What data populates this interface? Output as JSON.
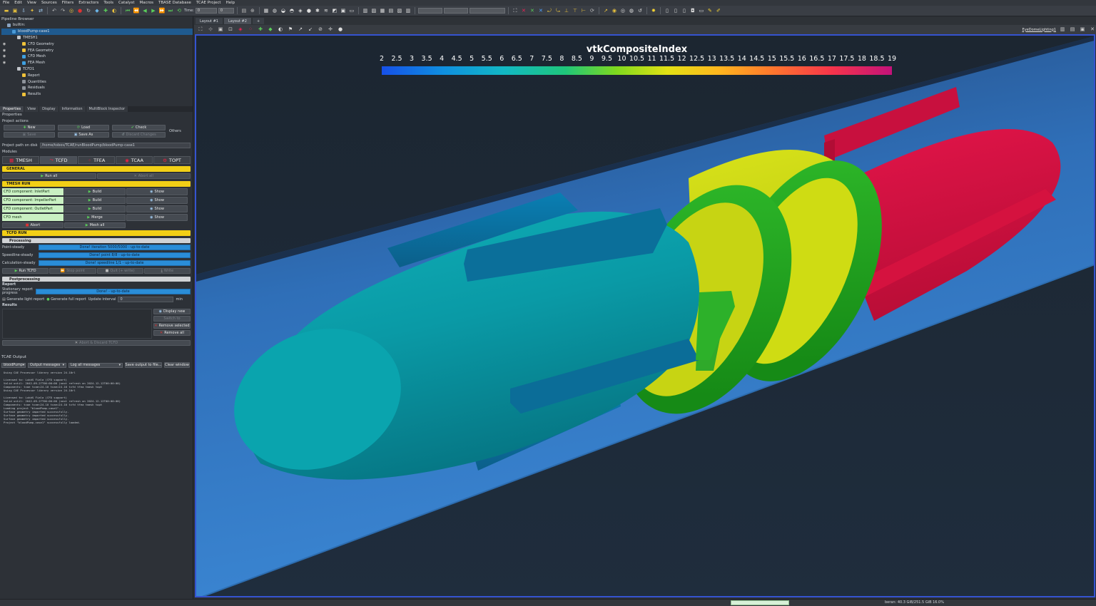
{
  "menu": [
    "File",
    "Edit",
    "View",
    "Sources",
    "Filters",
    "Extractors",
    "Tools",
    "Catalyst",
    "Macros",
    "TBASE Database",
    "TCAE Project",
    "Help"
  ],
  "toolbar": {
    "time_label": "Time:",
    "time_value": "0",
    "step_value": "0"
  },
  "pipeline": {
    "title": "Pipeline Browser",
    "items": [
      {
        "label": "builtin:",
        "indent": 0,
        "icon": "server-icon",
        "color": "#8aa3c0"
      },
      {
        "label": "bloodPump-case1",
        "indent": 1,
        "icon": "project-icon",
        "color": "#4a9bd8",
        "selected": true
      },
      {
        "label": "TMESH1",
        "indent": 2,
        "icon": "module-icon",
        "color": "#c0c4ca"
      },
      {
        "label": "CFD Geometry",
        "indent": 3,
        "icon": "geometry-icon",
        "color": "#f0c23a"
      },
      {
        "label": "FEA Geometry",
        "indent": 3,
        "icon": "geometry-icon",
        "color": "#f0c23a"
      },
      {
        "label": "CFD Mesh",
        "indent": 3,
        "icon": "mesh-icon",
        "color": "#3fa0e0"
      },
      {
        "label": "FEA Mesh",
        "indent": 3,
        "icon": "mesh-icon",
        "color": "#3fa0e0"
      },
      {
        "label": "TCFD1",
        "indent": 2,
        "icon": "module-icon",
        "color": "#c0c4ca"
      },
      {
        "label": "Report",
        "indent": 3,
        "icon": "report-icon",
        "color": "#f0c23a"
      },
      {
        "label": "Quantities",
        "indent": 3,
        "icon": "quantities-icon",
        "color": "#8d939a"
      },
      {
        "label": "Residuals",
        "indent": 3,
        "icon": "residuals-icon",
        "color": "#8d939a"
      },
      {
        "label": "Results",
        "indent": 3,
        "icon": "results-icon",
        "color": "#f0c23a"
      }
    ]
  },
  "prop_tabs": [
    "Properties",
    "View",
    "Display",
    "Information",
    "MultiBlock Inspector"
  ],
  "properties": {
    "title": "Properties",
    "project_actions": "Project actions",
    "new": "New",
    "load": "Load",
    "check": "Check",
    "save": "Save",
    "save_as": "Save As",
    "discard": "Discard Changes",
    "others": "Others",
    "path_label": "Project path on disk",
    "path_value": "/home/tobos/TCAE/runBloodPump/bloodPump-case1",
    "modules_label": "Modules",
    "modules": [
      "TMESH",
      "TCFD",
      "TFEA",
      "TCAA",
      "TOPT"
    ],
    "general": "GENERAL",
    "run_all": "Run all",
    "abort_all": "Abort all",
    "tmesh_run": "TMESH RUN",
    "mesh_rows": [
      {
        "name": "CFD component: InletPart",
        "action": "Build",
        "show": "Show"
      },
      {
        "name": "CFD component: ImpellerPart",
        "action": "Build",
        "show": "Show"
      },
      {
        "name": "CFD component: OutletPart",
        "action": "Build",
        "show": "Show"
      },
      {
        "name": "CFD mesh",
        "action": "Merge",
        "show": "Show"
      }
    ],
    "abort": "Abort",
    "mesh_all": "Mesh all",
    "tcfd_run": "TCFD RUN",
    "processing": "Processing",
    "proc_rows": [
      {
        "label": "Point-steady",
        "status": "Done! iteration 5000/5000 - up-to-date"
      },
      {
        "label": "Speedline-steady",
        "status": "Done! point 8/8 - up-to-date"
      },
      {
        "label": "Calculation-steady",
        "status": "Done! speedline 1/1 - up-to-date"
      }
    ],
    "run_tcfd": "Run TCFD",
    "stop_point": "Stop point",
    "quit": "Quit (+ write)",
    "write": "Write",
    "postprocessing": "Postprocessing",
    "report": "Report",
    "stationary_report": "Stationary report progress",
    "report_status": "Done! - up-to-date",
    "gen_light": "Generate light report",
    "gen_full": "Generate full report",
    "update_interval": "Update interval",
    "interval_value": "0",
    "interval_unit": "min",
    "results": "Results",
    "display_new": "Display new",
    "switch_to": "Switch to",
    "remove_selected": "Remove selected",
    "remove_all": "Remove all",
    "abort_discard": "Abort & Discard TCFD"
  },
  "output": {
    "title": "TCAE Output",
    "source": "bloodPump",
    "messages": "Output messages",
    "level": "Log all messages",
    "save": "Save output to file...",
    "clear": "Clear window",
    "lines": [
      "Using CAE Processor library version 24.10rl",
      "",
      "Licensed to: Lukáš Fiala (CFD support)",
      "Valid until: 2042-09-27T00:00:00 (next refresh on 2024-12-12T00:00:00)",
      "Components:  tcae tcae=24.10 tcae=24.10 tcfd tfea tmesh topt",
      "Using CAE Processor library version 24.10rl",
      "",
      "Licensed to: Lukáš Fiala (CFD support)",
      "Valid until: 2042-09-27T00:00:00 (next refresh on 2024-12-12T00:00:00)",
      "Components:  tcae tcae=24.10 tcae=24.10 tcfd tfea tmesh topt",
      "Loading project \"bloodPump-case1\"...",
      "Surface geometry imported successfully.",
      "Surface geometry imported successfully.",
      "Surface geometry imported successfully.",
      "Project \"bloodPump-case1\" successfully loaded."
    ]
  },
  "view_tabs": [
    "Layout #1",
    "Layout #2",
    "+"
  ],
  "view_plugin": "EyeDomeLighting1",
  "legend": {
    "title": "vtkCompositeIndex",
    "ticks": [
      "2",
      "2.5",
      "3",
      "3.5",
      "4",
      "4.5",
      "5",
      "5.5",
      "6",
      "6.5",
      "7",
      "7.5",
      "8",
      "8.5",
      "9",
      "9.5",
      "10",
      "10.5",
      "11",
      "11.5",
      "12",
      "12.5",
      "13",
      "13.5",
      "14",
      "14.5",
      "15",
      "15.5",
      "16",
      "16.5",
      "17",
      "17.5",
      "18",
      "18.5",
      "19"
    ],
    "min": 2,
    "max": 19
  },
  "status": {
    "memory": "beran: 40.3 GiB/251.5 GiB 16.0%"
  }
}
